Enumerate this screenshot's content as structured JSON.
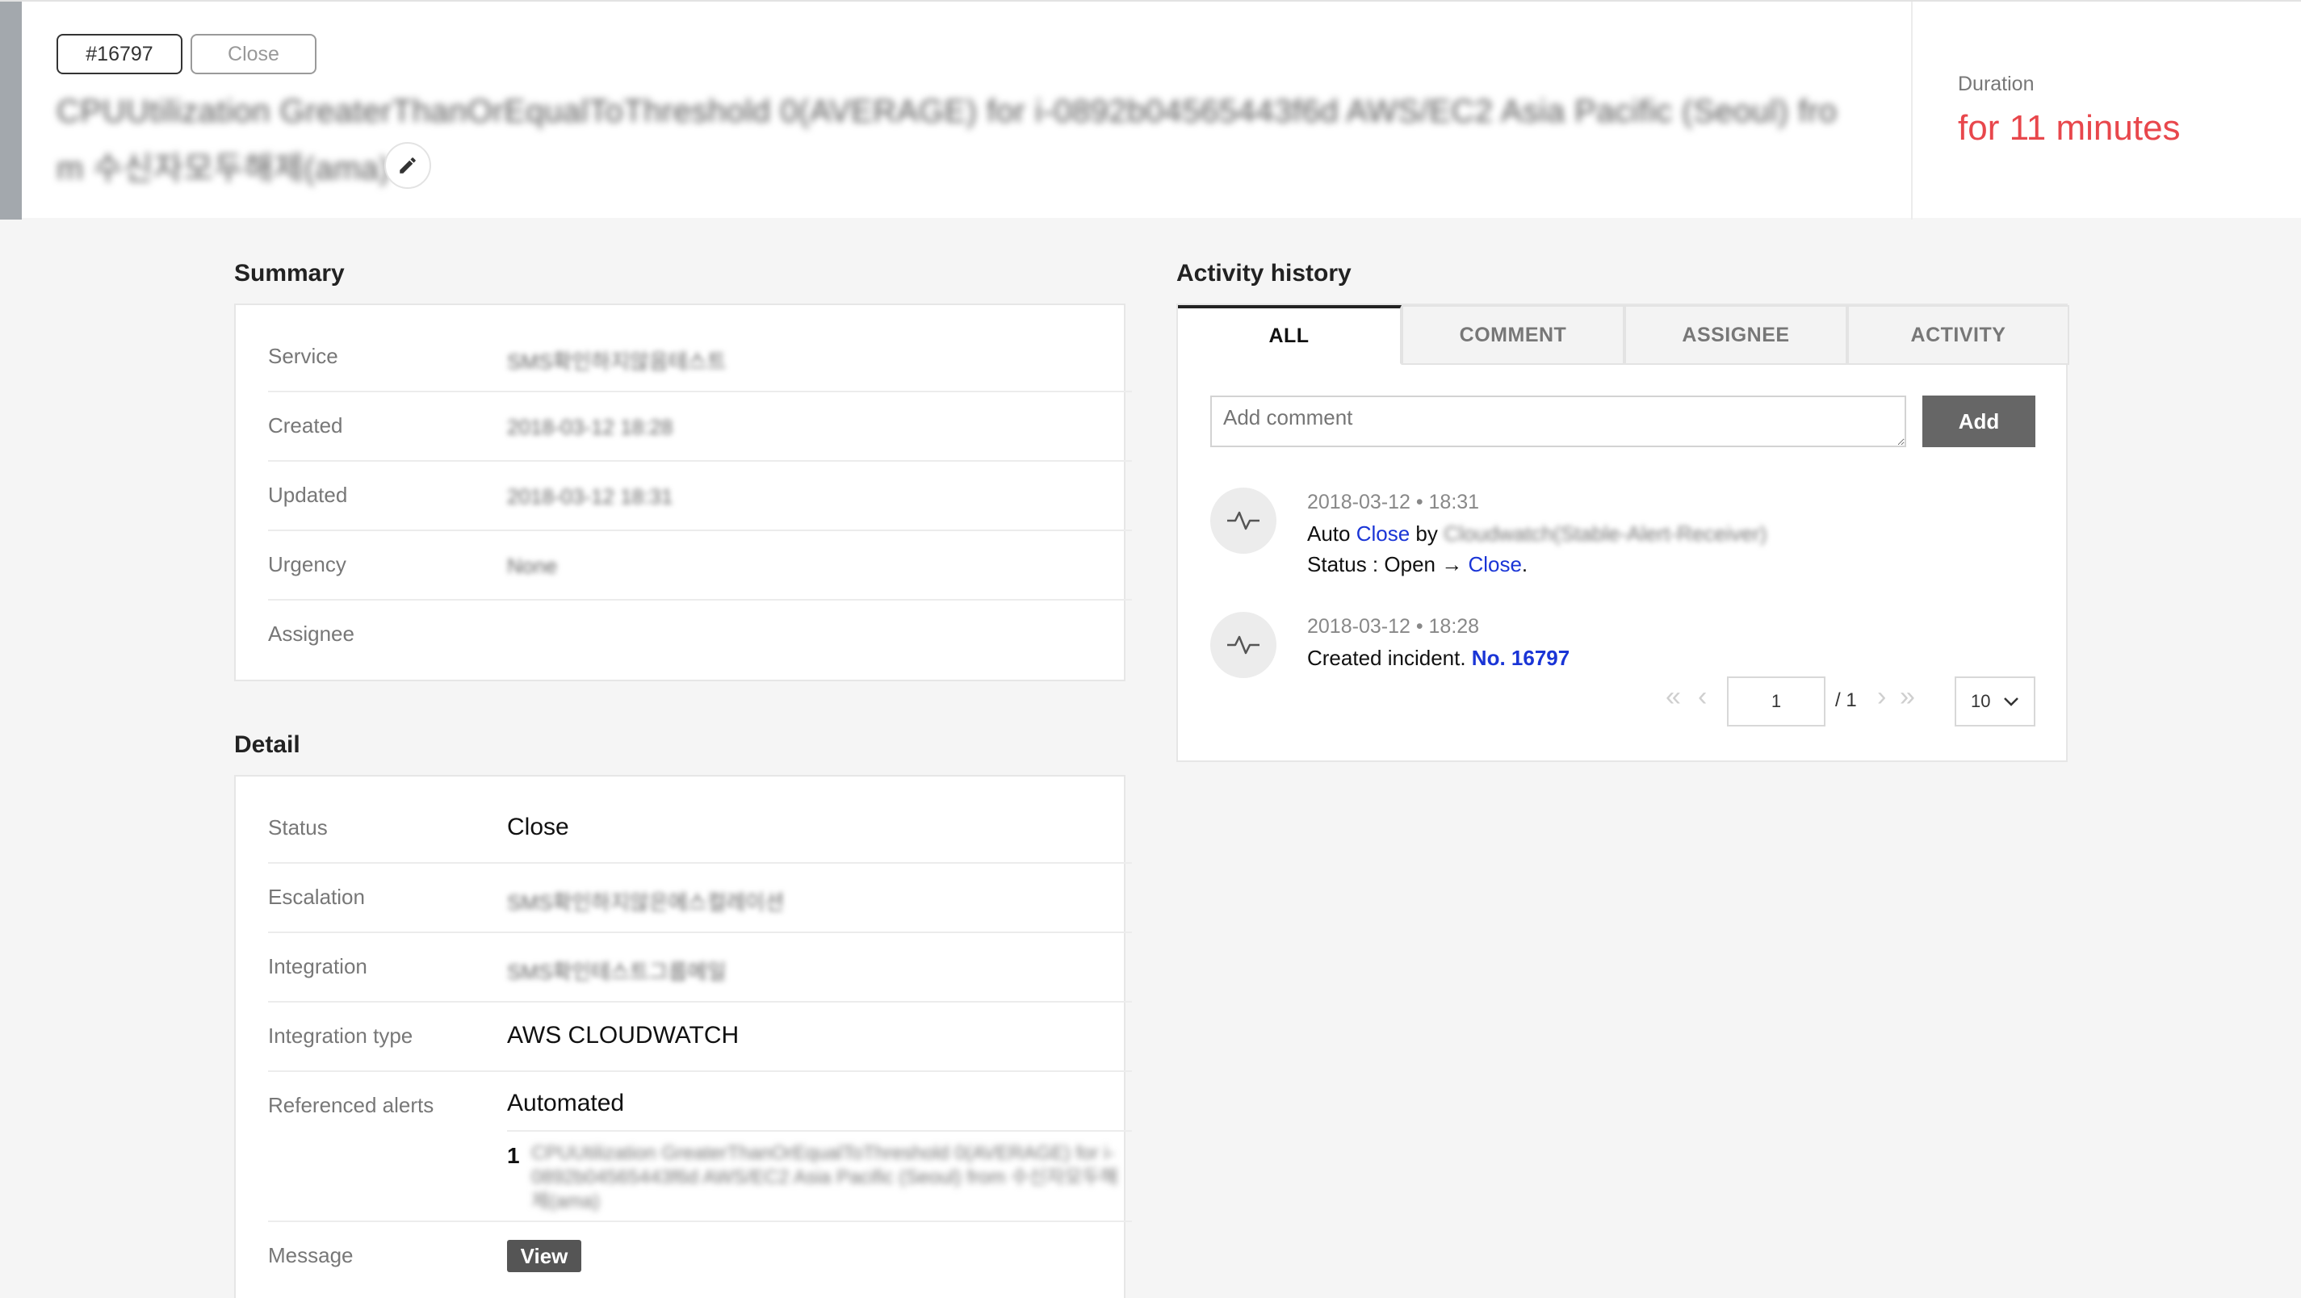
{
  "header": {
    "incident_id": "#16797",
    "status_badge": "Close",
    "title_line1": "CPUUtilization GreaterThanOrEqualToThreshold 0(AVERAGE) for i-0892b04565443f6d AWS/EC2 Asia Pacific (Seoul) fro",
    "title_line2": "m 수신자모두해제(ama)",
    "duration_label": "Duration",
    "duration_value": "for 11 minutes",
    "accent_color": "#a3a8ad",
    "duration_color": "#e8474c"
  },
  "summary": {
    "title": "Summary",
    "rows": [
      {
        "label": "Service",
        "value": "SMS확인하지않음테스트"
      },
      {
        "label": "Created",
        "value": "2018-03-12 18:28"
      },
      {
        "label": "Updated",
        "value": "2018-03-12 18:31"
      },
      {
        "label": "Urgency",
        "value": "None"
      },
      {
        "label": "Assignee",
        "value": ""
      }
    ]
  },
  "detail": {
    "title": "Detail",
    "status_label": "Status",
    "status_value": "Close",
    "escalation_label": "Escalation",
    "escalation_value": "SMS확인하지않은에스컬레이션",
    "integration_label": "Integration",
    "integration_value": "SMS확인테스트그룹메일",
    "integration_type_label": "Integration type",
    "integration_type_value": "AWS CLOUDWATCH",
    "referenced_alerts_label": "Referenced alerts",
    "referenced_alerts_value": "Automated",
    "referenced_alert_index": "1",
    "referenced_alert_text": "CPUUtilization GreaterThanOrEqualToThreshold 0(AVERAGE) for i-0892b04565443f6d AWS/EC2 Asia Pacific (Seoul) from 수신자모두해제(ama)",
    "message_label": "Message",
    "view_button": "View"
  },
  "activity": {
    "title": "Activity history",
    "tabs": [
      "ALL",
      "COMMENT",
      "ASSIGNEE",
      "ACTIVITY"
    ],
    "active_tab": "ALL",
    "comment_placeholder": "Add comment",
    "add_button": "Add",
    "items": [
      {
        "date": "2018-03-12 • 18:31",
        "line1_prefix": "Auto ",
        "line1_link": "Close",
        "line1_by": " by ",
        "line1_actor": "Cloudwatch(Stable-Alert-Receiver)",
        "line2_prefix": "Status : Open → ",
        "line2_link": "Close",
        "line2_suffix": "."
      },
      {
        "date": "2018-03-12 • 18:28",
        "line1_prefix": "Created incident. ",
        "line1_link": "No. 16797"
      }
    ],
    "pagination": {
      "current_page": "1",
      "total": "/ 1",
      "page_size": "10"
    }
  }
}
